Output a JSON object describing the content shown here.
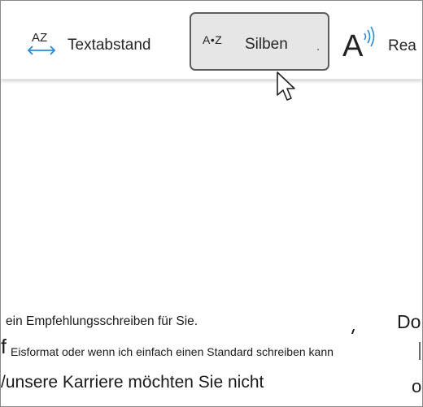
{
  "ribbon": {
    "textabstand": {
      "label": "Textabstand",
      "icon": "text-spacing-icon",
      "icon_text": "AZ"
    },
    "silben": {
      "label": "Silben",
      "icon": "syllables-icon",
      "icon_text": "A•Z"
    },
    "read": {
      "label": "Rea",
      "icon": "read-aloud-icon",
      "icon_text": "A"
    }
  },
  "document": {
    "line1": "ein Empfehlungsschreiben für Sie.",
    "line2_fragment": "f",
    "line3": "Eisformat oder wenn ich einfach einen Standard schreiben kann",
    "line4": "/unsere Karriere möchten Sie nicht",
    "right1": "Do",
    "right2": "o"
  },
  "colors": {
    "accent": "#2b88d8",
    "selected_bg": "#e6e6e6",
    "selected_border": "#5e5e5e"
  }
}
